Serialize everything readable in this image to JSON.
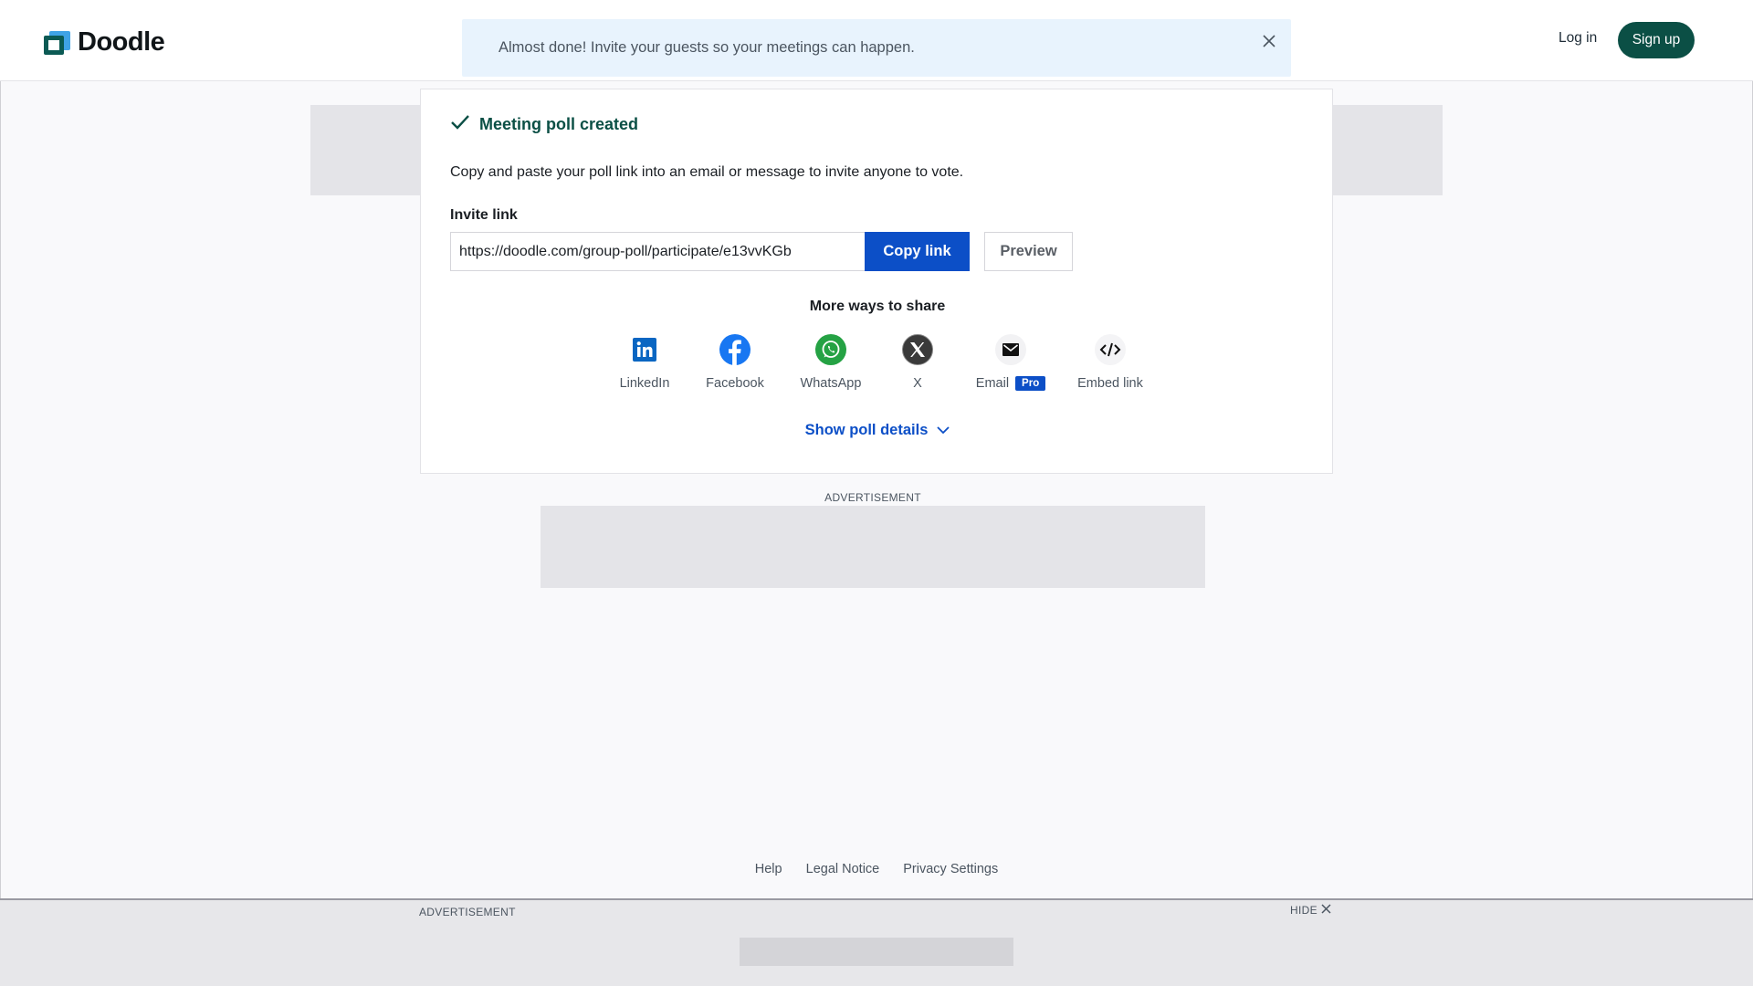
{
  "header": {
    "logo_text": "Doodle",
    "banner_text": "Almost done! Invite your guests so your meetings can happen.",
    "login_label": "Log in",
    "signup_label": "Sign up"
  },
  "card": {
    "success_title": "Meeting poll created",
    "description": "Copy and paste your poll link into an email or message to invite anyone to vote.",
    "invite_label": "Invite link",
    "invite_link": "https://doodle.com/group-poll/participate/e13vvKGb",
    "copy_label": "Copy link",
    "preview_label": "Preview",
    "more_ways": "More ways to share",
    "share": [
      {
        "label": "LinkedIn",
        "icon": "linkedin-icon"
      },
      {
        "label": "Facebook",
        "icon": "facebook-icon"
      },
      {
        "label": "WhatsApp",
        "icon": "whatsapp-icon"
      },
      {
        "label": "X",
        "icon": "x-icon"
      },
      {
        "label": "Email",
        "icon": "email-icon",
        "badge": "Pro"
      },
      {
        "label": "Embed link",
        "icon": "code-icon"
      }
    ],
    "show_details": "Show poll details"
  },
  "ads": {
    "mid_label": "ADVERTISEMENT",
    "bottom_label": "ADVERTISEMENT",
    "hide_label": "HIDE"
  },
  "footer": {
    "links": [
      "Help",
      "Legal Notice",
      "Privacy Settings"
    ]
  },
  "colors": {
    "brand_dark_green": "#0b4f45",
    "primary_blue": "#0c4fc7",
    "banner_bg": "#e8f3fd"
  }
}
